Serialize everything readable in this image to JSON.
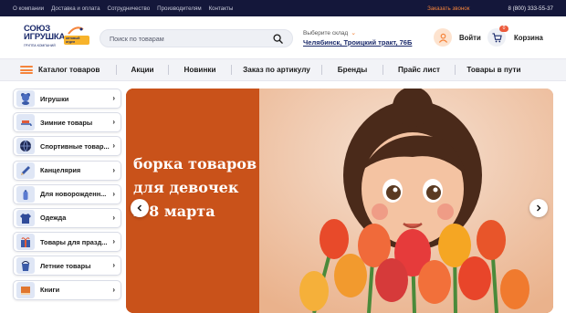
{
  "topbar": {
    "links": [
      "О компании",
      "Доставка и оплата",
      "Сотрудничество",
      "Производителям",
      "Контакты"
    ],
    "callback": "Заказать звонок",
    "phone": "8 (800) 333-55-37"
  },
  "logo": {
    "line1": "СОЮЗ",
    "line2": "ИГРУШКА",
    "sub": "ГРУППА КОМПАНИЙ",
    "tag": "оптовый отдел"
  },
  "search": {
    "placeholder": "Поиск по товарам"
  },
  "warehouse": {
    "label": "Выберите склад",
    "value": "Челябинск, Троицкий тракт, 76Б"
  },
  "user": {
    "login": "Войти"
  },
  "cart": {
    "label": "Корзина",
    "count": "0"
  },
  "nav": {
    "catalog": "Каталог товаров",
    "items": [
      "Акции",
      "Новинки",
      "Заказ по артикулу",
      "Бренды",
      "Прайс лист",
      "Товары в пути"
    ]
  },
  "categories": [
    {
      "label": "Игрушки",
      "icon": "teddy-bear-icon"
    },
    {
      "label": "Зимние товары",
      "icon": "sled-icon"
    },
    {
      "label": "Спортивные товар...",
      "icon": "ball-icon"
    },
    {
      "label": "Канцелярия",
      "icon": "pencil-icon"
    },
    {
      "label": "Для новорожденн...",
      "icon": "baby-bottle-icon"
    },
    {
      "label": "Одежда",
      "icon": "jacket-icon"
    },
    {
      "label": "Товары для празд...",
      "icon": "gift-icon"
    },
    {
      "label": "Летние товары",
      "icon": "bucket-icon"
    },
    {
      "label": "Книги",
      "icon": "book-icon"
    }
  ],
  "banner": {
    "line1": "борка товаров",
    "line2": "для девочек",
    "line3": "к 8 марта"
  },
  "colors": {
    "accent": "#f5843b",
    "topbar": "#14173a",
    "brand": "#1b2a6b",
    "banner": "#c9521a"
  }
}
